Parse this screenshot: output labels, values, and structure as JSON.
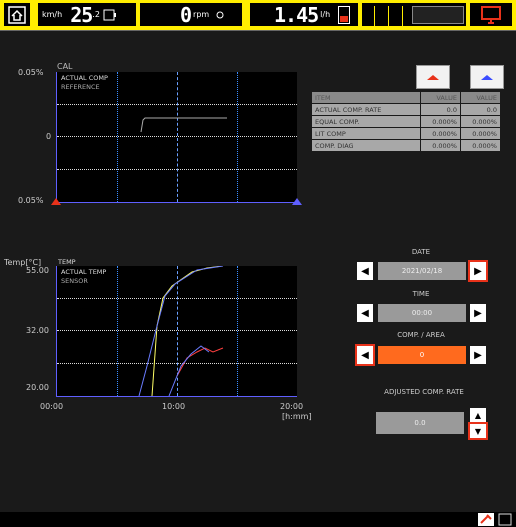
{
  "status_bar": {
    "speed_unit": "km/h",
    "speed_value": "25",
    "speed_suffix": ".2",
    "rpm_value": "0",
    "rpm_unit": "rpm",
    "fuel_value": "1.45",
    "fuel_unit": "l/h",
    "colors": {
      "background": "#ffee00",
      "alert": "#e8321a"
    }
  },
  "upper_chart": {
    "header_label": "CAL",
    "legend": [
      "ACTUAL COMP",
      "REFERENCE"
    ],
    "y_top": "0.05%",
    "y_mid": "0",
    "y_bottom": "0.05%"
  },
  "lower_chart": {
    "y_unit": "Temp[°C]",
    "y_top": "55.00",
    "legend": [
      "TEMP",
      "ACTUAL TEMP",
      "SENSOR"
    ],
    "y_mid": "32.00",
    "y_bottom": "20.00",
    "x_left": "00:00",
    "x_mid": "10:00",
    "x_right": "20:00",
    "x_unit": "[h:mm]",
    "line_colors": {
      "yellow": "#ffff66",
      "red": "#ff4040",
      "blue": "#6a7cff"
    }
  },
  "table": {
    "headers": [
      "ITEM",
      "VALUE",
      "VALUE"
    ],
    "rows": [
      [
        "ACTUAL COMP. RATE",
        "0.0",
        "0.0"
      ],
      [
        "EQUAL COMP.",
        "0.000%",
        "0.000%"
      ],
      [
        "LIT COMP",
        "0.000%",
        "0.000%"
      ],
      [
        "COMP. DIAG",
        "0.000%",
        "0.000%"
      ]
    ]
  },
  "controls": {
    "date_label": "DATE",
    "date_value": "2021/02/18",
    "time_label": "TIME",
    "time_value": "00:00",
    "comp_label": "COMP. / AREA",
    "comp_value": "0",
    "adjusted_label": "ADJUSTED COMP. RATE",
    "adjusted_value": "0.0"
  }
}
